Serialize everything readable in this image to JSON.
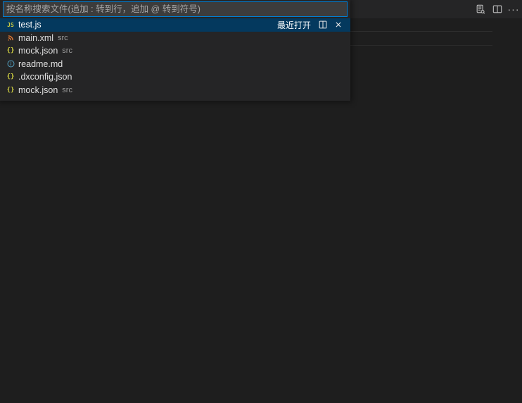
{
  "quick_open": {
    "placeholder": "按名称搜索文件(追加 : 转到行，追加 @ 转到符号)",
    "value": "",
    "recent_label": "最近打开",
    "items": [
      {
        "name": "test.js",
        "description": "",
        "icon": "javascript-file-icon",
        "selected": true
      },
      {
        "name": "main.xml",
        "description": "src",
        "icon": "xml-file-icon",
        "selected": false
      },
      {
        "name": "mock.json",
        "description": "src",
        "icon": "json-file-icon",
        "selected": false
      },
      {
        "name": "readme.md",
        "description": "",
        "icon": "info-file-icon",
        "selected": false
      },
      {
        "name": ".dxconfig.json",
        "description": "",
        "icon": "json-file-icon",
        "selected": false
      },
      {
        "name": "mock.json",
        "description": "src",
        "icon": "json-file-icon",
        "selected": false
      }
    ],
    "icon_glyphs": {
      "js": "JS",
      "json": "{}",
      "xml": "❟",
      "info": "ⓘ"
    }
  },
  "editor_actions": {
    "more": "···"
  },
  "colors": {
    "background": "#1e1e1e",
    "widget": "#252526",
    "selection": "#04395e",
    "focus_border": "#007fd4"
  }
}
